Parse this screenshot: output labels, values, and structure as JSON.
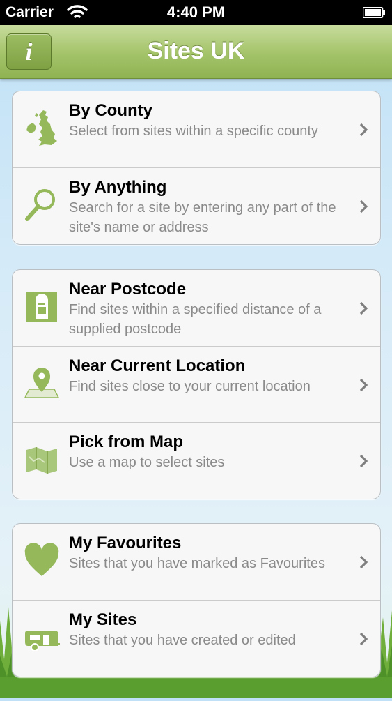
{
  "status_bar": {
    "carrier": "Carrier",
    "time": "4:40 PM"
  },
  "nav_bar": {
    "title": "Sites UK",
    "info_button_label": "i"
  },
  "groups": [
    {
      "rows": [
        {
          "title": "By County",
          "subtitle": "Select from sites within a specific county",
          "icon": "uk-map-icon"
        },
        {
          "title": "By Anything",
          "subtitle": "Search for a site by entering any part of the site's name or address",
          "icon": "search-icon"
        }
      ]
    },
    {
      "rows": [
        {
          "title": "Near Postcode",
          "subtitle": "Find sites within a specified distance of a supplied postcode",
          "icon": "postbox-icon"
        },
        {
          "title": "Near Current Location",
          "subtitle": "Find sites close to your current location",
          "icon": "location-pin-icon"
        },
        {
          "title": "Pick from Map",
          "subtitle": "Use a map to select sites",
          "icon": "folded-map-icon"
        }
      ]
    },
    {
      "rows": [
        {
          "title": "My Favourites",
          "subtitle": "Sites that you have marked as Favourites",
          "icon": "heart-icon"
        },
        {
          "title": "My Sites",
          "subtitle": "Sites that you have created or edited",
          "icon": "caravan-icon"
        }
      ]
    }
  ],
  "colors": {
    "accent_green": "#8fb252",
    "icon_green": "#94b85a",
    "subtitle_gray": "#8a8a8a"
  }
}
